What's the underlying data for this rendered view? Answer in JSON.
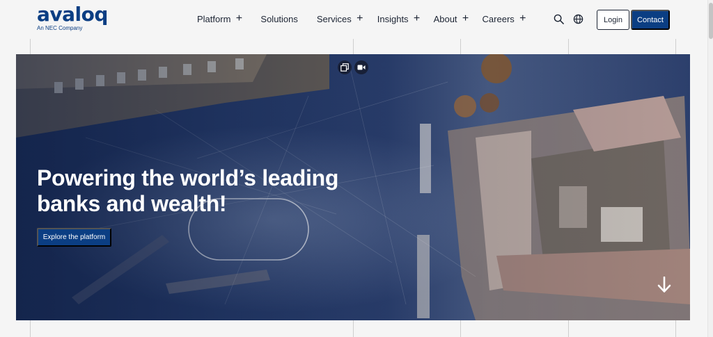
{
  "header": {
    "logo_text": "avaloq",
    "logo_subtitle": "An NEC Company",
    "nav": [
      {
        "label": "Platform",
        "expandable": true
      },
      {
        "label": "Solutions",
        "expandable": false
      },
      {
        "label": "Services",
        "expandable": true
      },
      {
        "label": "Insights",
        "expandable": true
      },
      {
        "label": "About",
        "expandable": true
      },
      {
        "label": "Careers",
        "expandable": true
      }
    ],
    "plus_glyph": "+",
    "login_label": "Login",
    "contact_label": "Contact",
    "icons": [
      "search-icon",
      "globe-icon"
    ]
  },
  "hero": {
    "title_line1": "Powering the world’s leading",
    "title_line2": "banks and wealth!",
    "cta_label": "Explore the platform",
    "controls": [
      "gallery-icon",
      "video-icon"
    ],
    "scroll_icon": "arrow-down-icon"
  },
  "colors": {
    "brand": "#0b3e83",
    "text": "#1c2433",
    "page_bg": "#f5f5f5",
    "hero_text": "#ffffff"
  }
}
